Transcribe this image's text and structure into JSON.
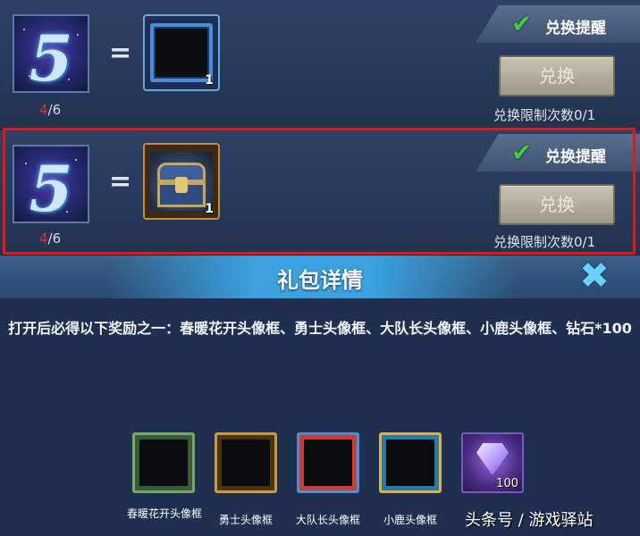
{
  "offers": [
    {
      "token_symbol": "5",
      "owned": "4",
      "required": "/6",
      "equals": "=",
      "reward_qty": "1",
      "reminder_label": "兑换提醒",
      "reminder_check": "✔",
      "exchange_label": "兑换",
      "limit_text": "兑换限制次数0/1"
    },
    {
      "token_symbol": "5",
      "owned": "4",
      "required": "/6",
      "equals": "=",
      "reward_qty": "1",
      "reminder_label": "兑换提醒",
      "reminder_check": "✔",
      "exchange_label": "兑换",
      "limit_text": "兑换限制次数0/1"
    }
  ],
  "dialog": {
    "title": "礼包详情",
    "close_glyph": "✖",
    "description": "打开后必得以下奖励之一：春暖花开头像框、勇士头像框、大队长头像框、小鹿头像框、钻石*100",
    "items": [
      {
        "name": "春暖花开头像框",
        "color": "#7aa86a"
      },
      {
        "name": "勇士头像框",
        "color": "#c99a3e"
      },
      {
        "name": "大队长头像框",
        "color": "#4a8fd6"
      },
      {
        "name": "小鹿头像框",
        "color": "#d9b04a"
      },
      {
        "name": "",
        "qty": "100",
        "color": "#7a5ab8"
      }
    ]
  },
  "watermark": "头条号 / 游戏驿站",
  "colors": {
    "highlight": "#e01818",
    "owned_count": "#e03030",
    "check": "#3fcf3a",
    "banner": "#3aa0de"
  }
}
